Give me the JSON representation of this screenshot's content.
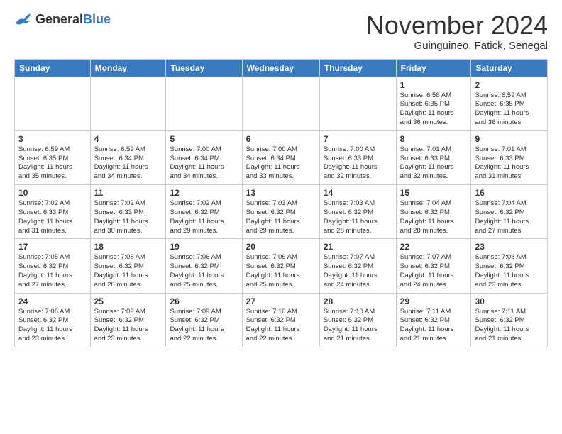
{
  "header": {
    "logo_general": "General",
    "logo_blue": "Blue",
    "month_title": "November 2024",
    "location": "Guinguineo, Fatick, Senegal"
  },
  "weekdays": [
    "Sunday",
    "Monday",
    "Tuesday",
    "Wednesday",
    "Thursday",
    "Friday",
    "Saturday"
  ],
  "weeks": [
    [
      {
        "day": "",
        "info": ""
      },
      {
        "day": "",
        "info": ""
      },
      {
        "day": "",
        "info": ""
      },
      {
        "day": "",
        "info": ""
      },
      {
        "day": "",
        "info": ""
      },
      {
        "day": "1",
        "info": "Sunrise: 6:58 AM\nSunset: 6:35 PM\nDaylight: 11 hours\nand 36 minutes."
      },
      {
        "day": "2",
        "info": "Sunrise: 6:59 AM\nSunset: 6:35 PM\nDaylight: 11 hours\nand 36 minutes."
      }
    ],
    [
      {
        "day": "3",
        "info": "Sunrise: 6:59 AM\nSunset: 6:35 PM\nDaylight: 11 hours\nand 35 minutes."
      },
      {
        "day": "4",
        "info": "Sunrise: 6:59 AM\nSunset: 6:34 PM\nDaylight: 11 hours\nand 34 minutes."
      },
      {
        "day": "5",
        "info": "Sunrise: 7:00 AM\nSunset: 6:34 PM\nDaylight: 11 hours\nand 34 minutes."
      },
      {
        "day": "6",
        "info": "Sunrise: 7:00 AM\nSunset: 6:34 PM\nDaylight: 11 hours\nand 33 minutes."
      },
      {
        "day": "7",
        "info": "Sunrise: 7:00 AM\nSunset: 6:33 PM\nDaylight: 11 hours\nand 32 minutes."
      },
      {
        "day": "8",
        "info": "Sunrise: 7:01 AM\nSunset: 6:33 PM\nDaylight: 11 hours\nand 32 minutes."
      },
      {
        "day": "9",
        "info": "Sunrise: 7:01 AM\nSunset: 6:33 PM\nDaylight: 11 hours\nand 31 minutes."
      }
    ],
    [
      {
        "day": "10",
        "info": "Sunrise: 7:02 AM\nSunset: 6:33 PM\nDaylight: 11 hours\nand 31 minutes."
      },
      {
        "day": "11",
        "info": "Sunrise: 7:02 AM\nSunset: 6:33 PM\nDaylight: 11 hours\nand 30 minutes."
      },
      {
        "day": "12",
        "info": "Sunrise: 7:02 AM\nSunset: 6:32 PM\nDaylight: 11 hours\nand 29 minutes."
      },
      {
        "day": "13",
        "info": "Sunrise: 7:03 AM\nSunset: 6:32 PM\nDaylight: 11 hours\nand 29 minutes."
      },
      {
        "day": "14",
        "info": "Sunrise: 7:03 AM\nSunset: 6:32 PM\nDaylight: 11 hours\nand 28 minutes."
      },
      {
        "day": "15",
        "info": "Sunrise: 7:04 AM\nSunset: 6:32 PM\nDaylight: 11 hours\nand 28 minutes."
      },
      {
        "day": "16",
        "info": "Sunrise: 7:04 AM\nSunset: 6:32 PM\nDaylight: 11 hours\nand 27 minutes."
      }
    ],
    [
      {
        "day": "17",
        "info": "Sunrise: 7:05 AM\nSunset: 6:32 PM\nDaylight: 11 hours\nand 27 minutes."
      },
      {
        "day": "18",
        "info": "Sunrise: 7:05 AM\nSunset: 6:32 PM\nDaylight: 11 hours\nand 26 minutes."
      },
      {
        "day": "19",
        "info": "Sunrise: 7:06 AM\nSunset: 6:32 PM\nDaylight: 11 hours\nand 25 minutes."
      },
      {
        "day": "20",
        "info": "Sunrise: 7:06 AM\nSunset: 6:32 PM\nDaylight: 11 hours\nand 25 minutes."
      },
      {
        "day": "21",
        "info": "Sunrise: 7:07 AM\nSunset: 6:32 PM\nDaylight: 11 hours\nand 24 minutes."
      },
      {
        "day": "22",
        "info": "Sunrise: 7:07 AM\nSunset: 6:32 PM\nDaylight: 11 hours\nand 24 minutes."
      },
      {
        "day": "23",
        "info": "Sunrise: 7:08 AM\nSunset: 6:32 PM\nDaylight: 11 hours\nand 23 minutes."
      }
    ],
    [
      {
        "day": "24",
        "info": "Sunrise: 7:08 AM\nSunset: 6:32 PM\nDaylight: 11 hours\nand 23 minutes."
      },
      {
        "day": "25",
        "info": "Sunrise: 7:09 AM\nSunset: 6:32 PM\nDaylight: 11 hours\nand 23 minutes."
      },
      {
        "day": "26",
        "info": "Sunrise: 7:09 AM\nSunset: 6:32 PM\nDaylight: 11 hours\nand 22 minutes."
      },
      {
        "day": "27",
        "info": "Sunrise: 7:10 AM\nSunset: 6:32 PM\nDaylight: 11 hours\nand 22 minutes."
      },
      {
        "day": "28",
        "info": "Sunrise: 7:10 AM\nSunset: 6:32 PM\nDaylight: 11 hours\nand 21 minutes."
      },
      {
        "day": "29",
        "info": "Sunrise: 7:11 AM\nSunset: 6:32 PM\nDaylight: 11 hours\nand 21 minutes."
      },
      {
        "day": "30",
        "info": "Sunrise: 7:11 AM\nSunset: 6:32 PM\nDaylight: 11 hours\nand 21 minutes."
      }
    ]
  ]
}
